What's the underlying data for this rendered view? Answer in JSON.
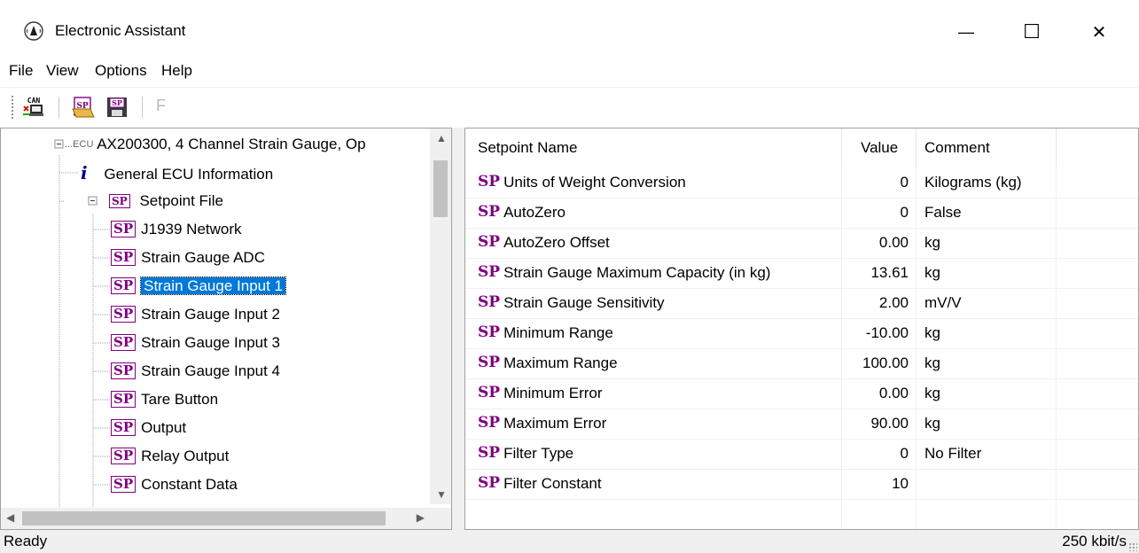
{
  "window": {
    "title": "Electronic Assistant",
    "minimize_glyph": "—",
    "maximize_glyph": "☐",
    "close_glyph": "✕"
  },
  "menu": [
    "File",
    "View",
    "Options",
    "Help"
  ],
  "toolbar": {
    "can_label": "CAN",
    "sp_label": "SP",
    "f_label": "F"
  },
  "tree": {
    "ecu_prefix": "ECU",
    "ecu_label": "AX200300, 4 Channel Strain Gauge, Op",
    "info_icon": "i",
    "info_label": "General ECU Information",
    "setpoint_file_label": "Setpoint File",
    "badge": "SP",
    "items": [
      "J1939 Network",
      "Strain Gauge ADC",
      "Strain Gauge Input 1",
      "Strain Gauge Input 2",
      "Strain Gauge Input 3",
      "Strain Gauge Input 4",
      "Tare Button",
      "Output",
      "Relay Output",
      "Constant Data"
    ],
    "selected_index": 2
  },
  "table": {
    "headers": [
      "Setpoint Name",
      "Value",
      "Comment"
    ],
    "badge": "SP",
    "rows": [
      {
        "name": "Units of Weight Conversion",
        "value": "0",
        "comment": "Kilograms (kg)"
      },
      {
        "name": "AutoZero",
        "value": "0",
        "comment": "False"
      },
      {
        "name": "AutoZero Offset",
        "value": "0.00",
        "comment": "kg"
      },
      {
        "name": "Strain Gauge Maximum Capacity (in kg)",
        "value": "13.61",
        "comment": "kg"
      },
      {
        "name": "Strain Gauge Sensitivity",
        "value": "2.00",
        "comment": "mV/V"
      },
      {
        "name": "Minimum Range",
        "value": "-10.00",
        "comment": "kg"
      },
      {
        "name": "Maximum Range",
        "value": "100.00",
        "comment": "kg"
      },
      {
        "name": "Minimum Error",
        "value": "0.00",
        "comment": "kg"
      },
      {
        "name": "Maximum Error",
        "value": "90.00",
        "comment": "kg"
      },
      {
        "name": "Filter Type",
        "value": "0",
        "comment": "No Filter"
      },
      {
        "name": "Filter Constant",
        "value": "10",
        "comment": ""
      }
    ]
  },
  "status": {
    "left": "Ready",
    "right": "250 kbit/s"
  },
  "colors": {
    "sp_purple": "#800080",
    "selection": "#0078d7"
  }
}
